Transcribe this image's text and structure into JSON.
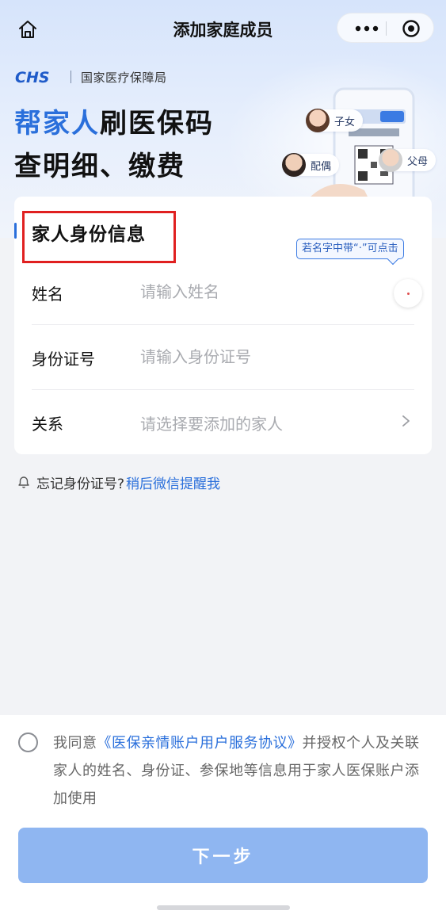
{
  "nav": {
    "title": "添加家庭成员",
    "icons": {
      "home": "home-icon",
      "more": "more-dots-icon",
      "close": "target-close-icon"
    }
  },
  "brand": {
    "logo_text": "CHS",
    "agency": "国家医疗保障局"
  },
  "hero": {
    "headline1_highlight": "帮家人",
    "headline1_rest": "刷医保码",
    "headline2": "查明细、缴费",
    "roles": {
      "child": "子女",
      "spouse": "配偶",
      "parents": "父母"
    }
  },
  "form": {
    "title": "家人身份信息",
    "tip": "若名字中带“·”可点击",
    "fields": {
      "name": {
        "label": "姓名",
        "placeholder": "请输入姓名",
        "value": ""
      },
      "id_number": {
        "label": "身份证号",
        "placeholder": "请输入身份证号",
        "value": ""
      },
      "relation": {
        "label": "关系",
        "placeholder": "请选择要添加的家人",
        "value": ""
      }
    },
    "dot_button": "·"
  },
  "forgot": {
    "text": "忘记身份证号?",
    "link": "稍后微信提醒我"
  },
  "agreement": {
    "checked": false,
    "prefix": "我同意",
    "protocol": "《医保亲情账户用户服务协议》",
    "suffix": "并授权个人及关联家人的姓名、身份证、参保地等信息用于家人医保账户添加使用"
  },
  "actions": {
    "next_label": "下一步"
  },
  "colors": {
    "accent": "#2a6fdb",
    "button_disabled": "#8fb6f1",
    "highlight_border": "#e02020"
  }
}
